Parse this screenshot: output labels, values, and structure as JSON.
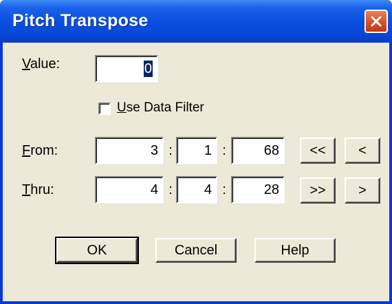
{
  "window": {
    "title": "Pitch Transpose",
    "close_icon": "close-icon"
  },
  "value": {
    "label_underlined": "V",
    "label_rest": "alue:",
    "field_value": "0"
  },
  "filter": {
    "label_underlined": "U",
    "label_rest": "se Data Filter",
    "checked": false
  },
  "from": {
    "label_underlined": "F",
    "label_rest": "rom:",
    "bar": "3",
    "beat": "1",
    "tick": "68",
    "btn_first": "<<",
    "btn_prev": "<"
  },
  "thru": {
    "label_underlined": "T",
    "label_rest": "hru:",
    "bar": "4",
    "beat": "4",
    "tick": "28",
    "btn_last": ">>",
    "btn_next": ">"
  },
  "separator": ":",
  "buttons": {
    "ok": "OK",
    "cancel": "Cancel",
    "help": "Help"
  }
}
